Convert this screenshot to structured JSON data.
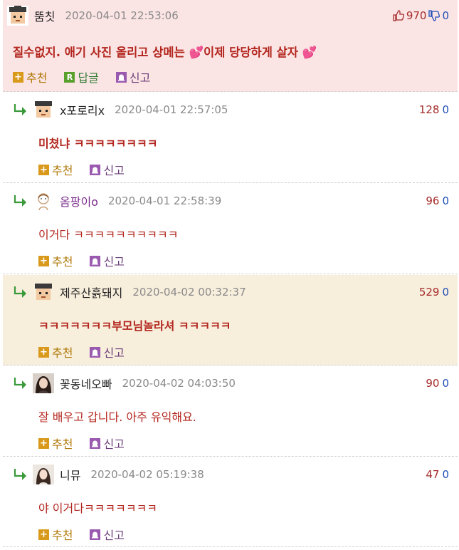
{
  "colors": {
    "highlight_bg": "#fbe4e4",
    "best_bg": "#f7eedc",
    "upvote": "#a52a2a",
    "downvote": "#1f4fb8"
  },
  "actions": {
    "recommend": "추천",
    "reply": "답글",
    "report": "신고"
  },
  "comments": [
    {
      "nickname": "뚬칫",
      "date": "2020-04-01 22:53:06",
      "up": "970",
      "down": "0",
      "text": "질수없지. 애기 사진 올리고 상메는 💕이제 당당하게 살자 💕",
      "avatar_icon": "pixel-face-avatar-icon"
    },
    {
      "nickname": "x포로리x",
      "date": "2020-04-01 22:57:05",
      "up": "128",
      "down": "0",
      "text": "미쳤냐 ㅋㅋㅋㅋㅋㅋㅋㅋ",
      "avatar_icon": "pixel-face-avatar-icon"
    },
    {
      "nickname": "옴팡이o",
      "date": "2020-04-01 22:58:39",
      "up": "96",
      "down": "0",
      "text": "이거다 ㅋㅋㅋㅋㅋㅋㅋㅋㅋㅋ",
      "avatar_icon": "sketch-girl-avatar-icon"
    },
    {
      "nickname": "제주산흙돼지",
      "date": "2020-04-02 00:32:37",
      "up": "529",
      "down": "0",
      "text": "ㅋㅋㅋㅋㅋㅋㅋ부모님놀라셔 ㅋㅋㅋㅋㅋ",
      "avatar_icon": "pixel-face-avatar-icon"
    },
    {
      "nickname": "꽃동네오빠",
      "date": "2020-04-02 04:03:50",
      "up": "90",
      "down": "0",
      "text": "잘 배우고 갑니다. 아주 유익해요.",
      "avatar_icon": "photo-avatar-icon"
    },
    {
      "nickname": "니뮤",
      "date": "2020-04-02 05:19:38",
      "up": "47",
      "down": "0",
      "text": "야 이거다ㅋㅋㅋㅋㅋㅋㅋ",
      "avatar_icon": "photo-avatar-icon"
    }
  ]
}
